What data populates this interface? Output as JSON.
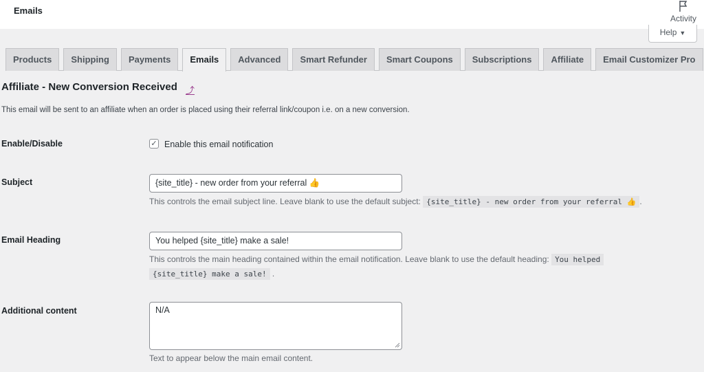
{
  "topbar": {
    "title": "Emails",
    "activity_label": "Activity",
    "help_label": "Help",
    "help_caret": "▼"
  },
  "tabs": [
    {
      "label": "Products",
      "active": false
    },
    {
      "label": "Shipping",
      "active": false
    },
    {
      "label": "Payments",
      "active": false
    },
    {
      "label": "Emails",
      "active": true
    },
    {
      "label": "Advanced",
      "active": false
    },
    {
      "label": "Smart Refunder",
      "active": false
    },
    {
      "label": "Smart Coupons",
      "active": false
    },
    {
      "label": "Subscriptions",
      "active": false
    },
    {
      "label": "Affiliate",
      "active": false
    },
    {
      "label": "Email Customizer Pro",
      "active": false
    }
  ],
  "section": {
    "title": "Affiliate - New Conversion Received",
    "up_link": "⤴",
    "description": "This email will be sent to an affiliate when an order is placed using their referral link/coupon i.e. on a new conversion."
  },
  "fields": {
    "enable": {
      "label": "Enable/Disable",
      "checked": true,
      "checkbox_label": "Enable this email notification"
    },
    "subject": {
      "label": "Subject",
      "value": "{site_title} - new order from your referral 👍",
      "help_prefix": "This controls the email subject line. Leave blank to use the default subject:",
      "help_code": "{site_title} - new order from your referral 👍",
      "help_suffix": "."
    },
    "heading": {
      "label": "Email Heading",
      "value": "You helped {site_title} make a sale!",
      "help_prefix": "This controls the main heading contained within the email notification. Leave blank to use the default heading:",
      "help_code_line1": "You helped",
      "help_code_line2": "{site_title} make a sale!",
      "help_suffix": "."
    },
    "additional": {
      "label": "Additional content",
      "value": "N/A",
      "help": "Text to appear below the main email content."
    }
  },
  "colors": {
    "link": "#9b3e8f",
    "tab_bg": "#dcdcde",
    "page_bg": "#f0f0f1"
  }
}
